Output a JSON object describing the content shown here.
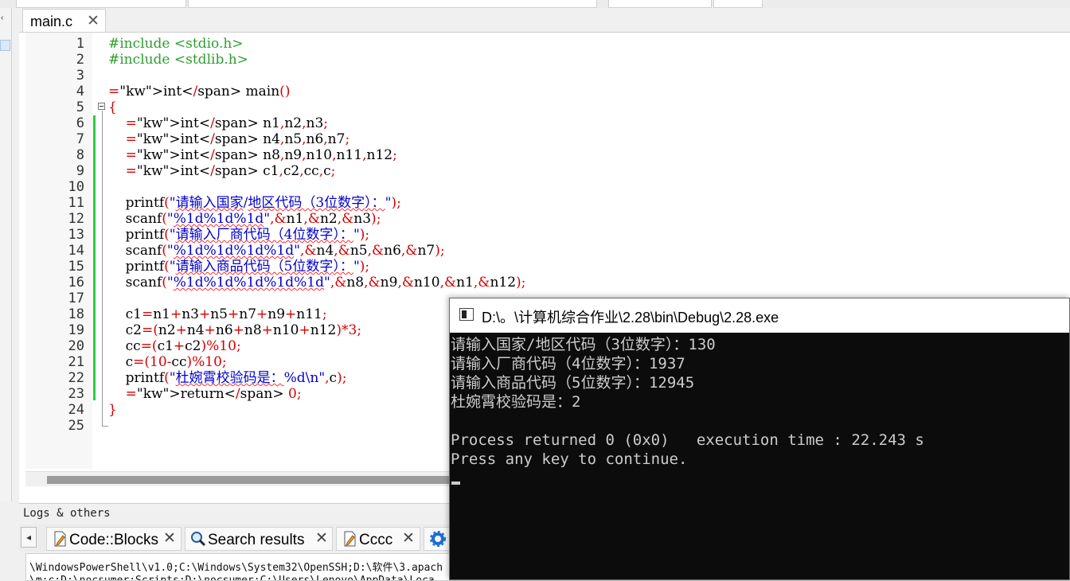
{
  "editor": {
    "tab_label": "main.c",
    "tab_close": "✕",
    "line_numbers": [
      "1",
      "2",
      "3",
      "4",
      "5",
      "6",
      "7",
      "8",
      "9",
      "10",
      "11",
      "12",
      "13",
      "14",
      "15",
      "16",
      "17",
      "18",
      "19",
      "20",
      "21",
      "22",
      "23",
      "24",
      "25"
    ],
    "code_lines": [
      "#include <stdio.h>",
      "#include <stdlib.h>",
      "",
      "int main()",
      "{",
      "    int n1,n2,n3;",
      "    int n4,n5,n6,n7;",
      "    int n8,n9,n10,n11,n12;",
      "    int c1,c2,cc,c;",
      "",
      "    printf(\"请输入国家/地区代码（3位数字）：\");",
      "    scanf(\"%1d%1d%1d\",&n1,&n2,&n3);",
      "    printf(\"请输入厂商代码（4位数字）：\");",
      "    scanf(\"%1d%1d%1d%1d\",&n4,&n5,&n6,&n7);",
      "    printf(\"请输入商品代码（5位数字）：\");",
      "    scanf(\"%1d%1d%1d%1d%1d\",&n8,&n9,&n10,&n1,&n12);",
      "",
      "    c1=n1+n3+n5+n7+n9+n11;",
      "    c2=(n2+n4+n6+n8+n10+n12)*3;",
      "    cc=(c1+c2)%10;",
      "    c=(10-cc)%10;",
      "    printf(\"杜婉霄校验码是：%d\\n\",c);",
      "    return 0;",
      "}",
      ""
    ]
  },
  "logs": {
    "title": "Logs & others",
    "scroll_left": "◂",
    "tabs": [
      {
        "label": "Code::Blocks",
        "close": "✕"
      },
      {
        "label": "Search results",
        "close": "✕"
      },
      {
        "label": "Cccc",
        "close": "✕"
      }
    ],
    "text_line1": "\\WindowsPowerShell\\v1.0;C:\\Windows\\System32\\OpenSSH;D:\\软件\\3.apach",
    "text_line2": "\\m;c;D:\\nocsumer;Scripts;D:\\nocsumer;C:\\Users\\Lenovo\\AppData\\Loca"
  },
  "console": {
    "title": "D:\\。\\计算机综合作业\\2.28\\bin\\Debug\\2.28.exe",
    "lines": [
      "请输入国家/地区代码（3位数字）：130",
      "请输入厂商代码（4位数字）：1937",
      "请输入商品代码（5位数字）：12945",
      "杜婉霄校验码是：2",
      "",
      "Process returned 0 (0x0)   execution time : 22.243 s",
      "Press any key to continue."
    ]
  },
  "colors": {
    "keyword": "#00008b",
    "preprocessor": "#2e9e2e",
    "string": "#0000d0",
    "number_operator": "#d40000",
    "change_bar": "#2ecc40",
    "console_bg": "#0c0c0c",
    "console_text": "#cccccc"
  },
  "icons": {
    "codeblocks_tab": "document-pencil-icon",
    "search_tab": "magnifier-icon",
    "cccc_tab": "document-pencil-icon",
    "next_tab": "gear-icon",
    "console_window": "console-window-icon"
  }
}
